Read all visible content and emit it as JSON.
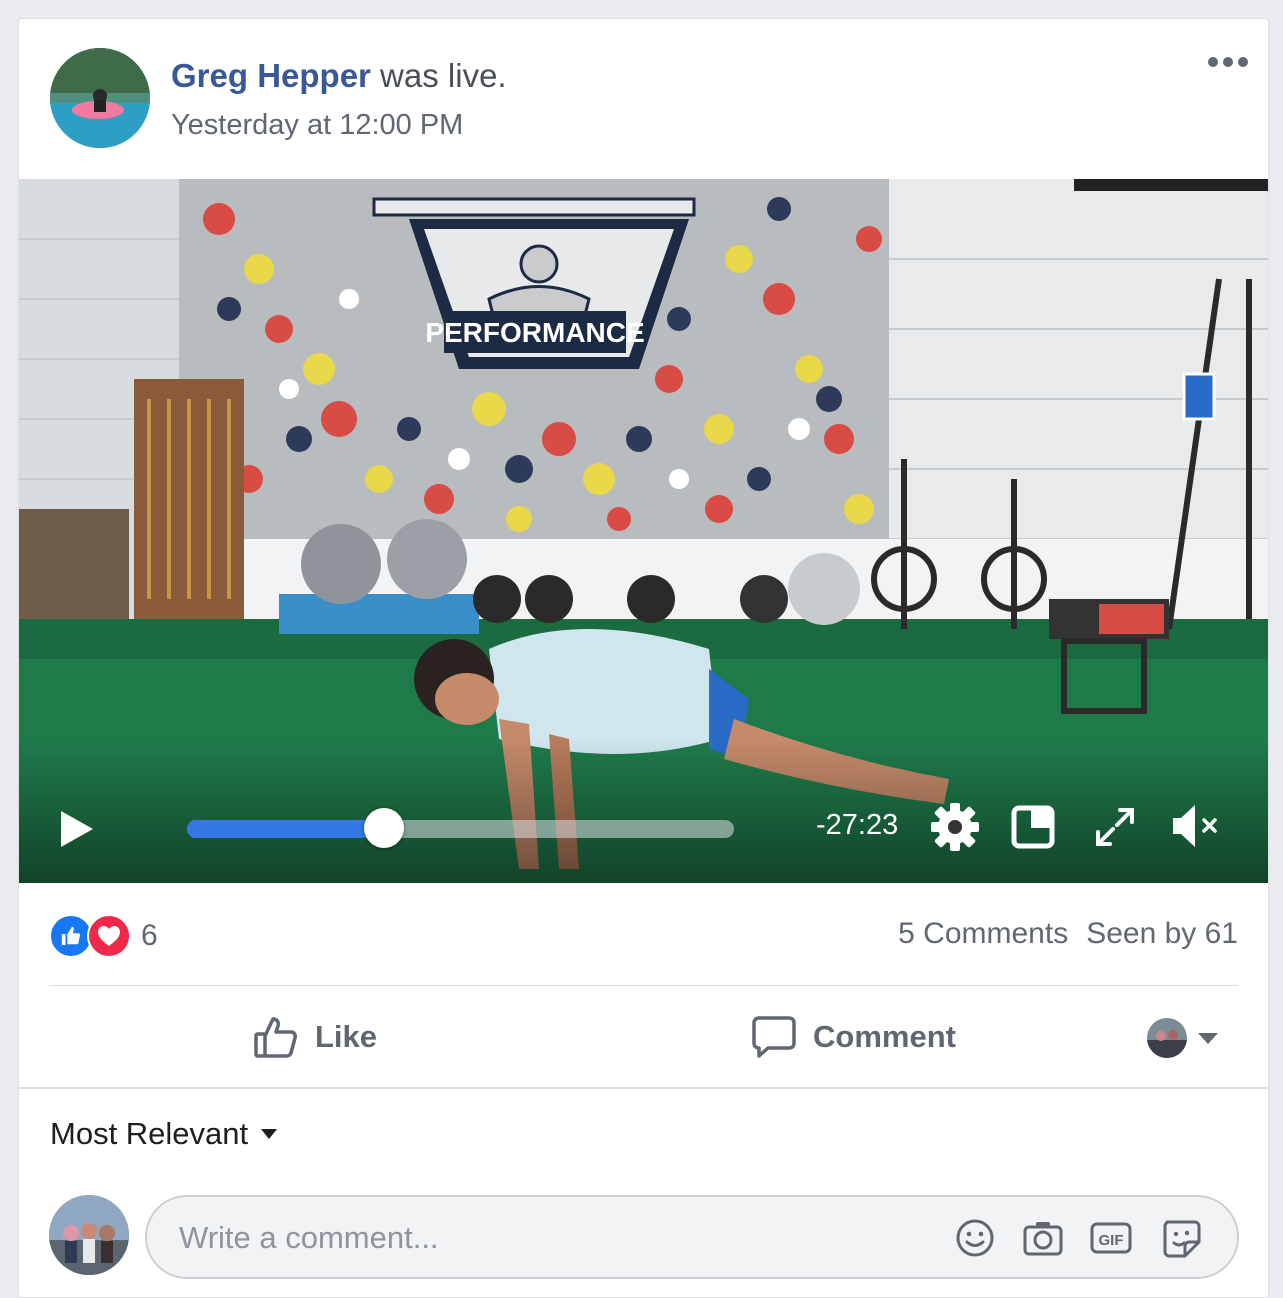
{
  "post": {
    "author": "Greg Hepper",
    "action": " was live.",
    "timestamp": "Yesterday at 12:00 PM"
  },
  "video": {
    "banner_text": "PERFORMANCE",
    "time_remaining": "-27:23",
    "progress": 0.36,
    "muted": true
  },
  "reactions": {
    "count": "6",
    "types": [
      "like",
      "love"
    ]
  },
  "stats": {
    "comments": "5 Comments",
    "seen": "Seen by 61"
  },
  "actions": {
    "like_label": "Like",
    "comment_label": "Comment"
  },
  "comments": {
    "sort_label": "Most Relevant",
    "input_placeholder": "Write a comment...",
    "gif_label": "GIF"
  },
  "colors": {
    "author_link": "#385898",
    "progress_fill": "#3578e5",
    "floor_green": "#1f7a4a"
  }
}
